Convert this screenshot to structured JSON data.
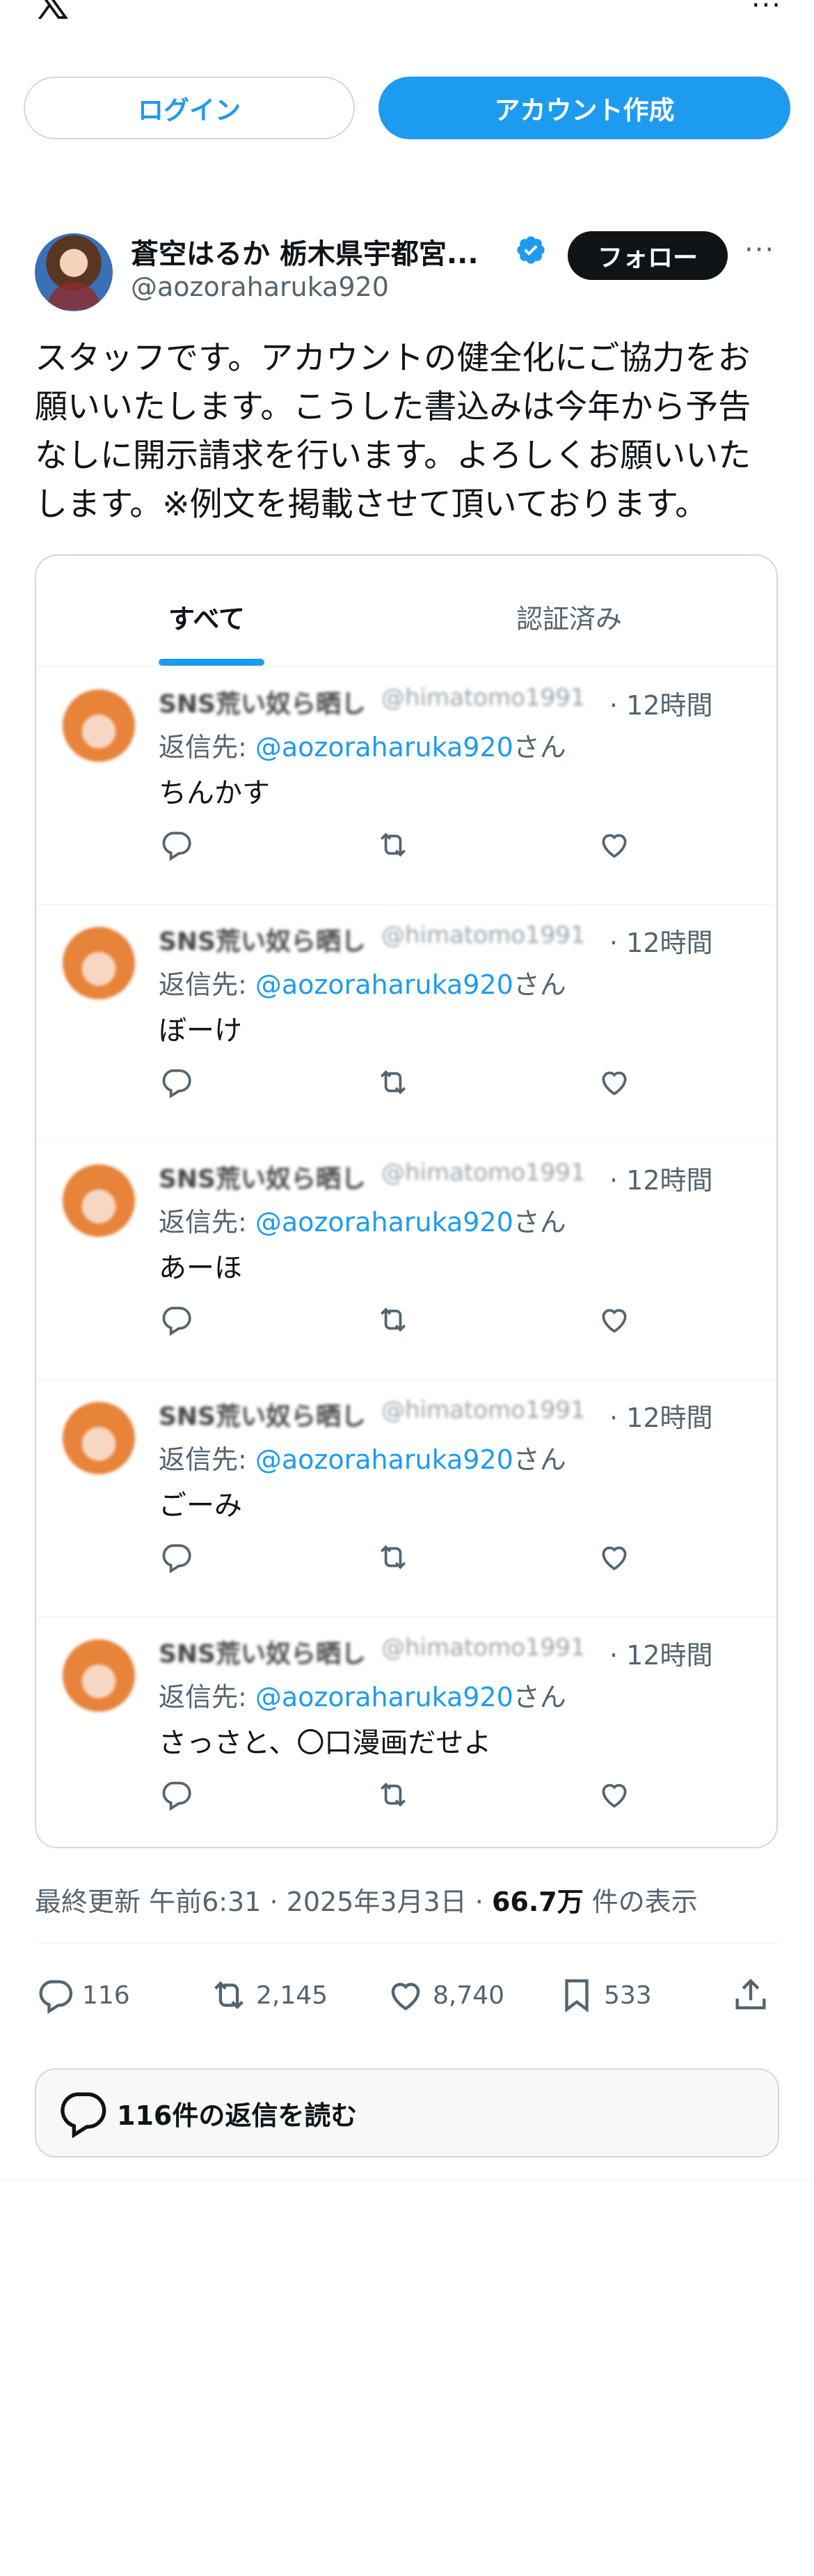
{
  "header": {
    "logo": "𝕏",
    "more": "···"
  },
  "auth": {
    "login_label": "ログイン",
    "signup_label": "アカウント作成"
  },
  "author": {
    "display_name": "蒼空はるか 栃木県宇都宮...",
    "handle": "@aozoraharuka920",
    "follow_label": "フォロー",
    "more": "···",
    "verified_color": "#1d9bf0"
  },
  "tweet": {
    "text_lines": [
      "スタッフです。アカウントの健全化にご協力をお",
      "願いいたします。こうした書込みは今年から予告",
      "なしに開示請求を行います。よろしくお願いいた",
      "します。※例文を掲載させて頂いております。"
    ]
  },
  "card": {
    "tabs": [
      {
        "label": "すべて",
        "active": true
      },
      {
        "label": "認証済み",
        "active": false
      }
    ],
    "replies": [
      {
        "name": "SNS荒い奴ら晒し",
        "handle": "@himatomo1991",
        "time": "· 12時間",
        "reply_prefix": "返信先: ",
        "mention": "@aozoraharuka920",
        "suffix": "さん",
        "text": "ちんかす"
      },
      {
        "name": "SNS荒い奴ら晒し",
        "handle": "@himatomo1991",
        "time": "· 12時間",
        "reply_prefix": "返信先: ",
        "mention": "@aozoraharuka920",
        "suffix": "さん",
        "text": "ぼーけ"
      },
      {
        "name": "SNS荒い奴ら晒し",
        "handle": "@himatomo1991",
        "time": "· 12時間",
        "reply_prefix": "返信先: ",
        "mention": "@aozoraharuka920",
        "suffix": "さん",
        "text": "あーほ"
      },
      {
        "name": "SNS荒い奴ら晒し",
        "handle": "@himatomo1991",
        "time": "· 12時間",
        "reply_prefix": "返信先: ",
        "mention": "@aozoraharuka920",
        "suffix": "さん",
        "text": "ごーみ"
      },
      {
        "name": "SNS荒い奴ら晒し",
        "handle": "@himatomo1991",
        "time": "· 12時間",
        "reply_prefix": "返信先: ",
        "mention": "@aozoraharuka920",
        "suffix": "さん",
        "text": "さっさと、〇口漫画だせよ"
      }
    ]
  },
  "meta": {
    "prefix": "最終更新 午前6:31 · 2025年3月3日 · ",
    "views": "66.7万",
    "views_suffix": " 件の表示"
  },
  "actions": {
    "replies": "116",
    "reposts": "2,145",
    "likes": "8,740",
    "bookmarks": "533"
  },
  "read_replies_label": "116件の返信を読む"
}
